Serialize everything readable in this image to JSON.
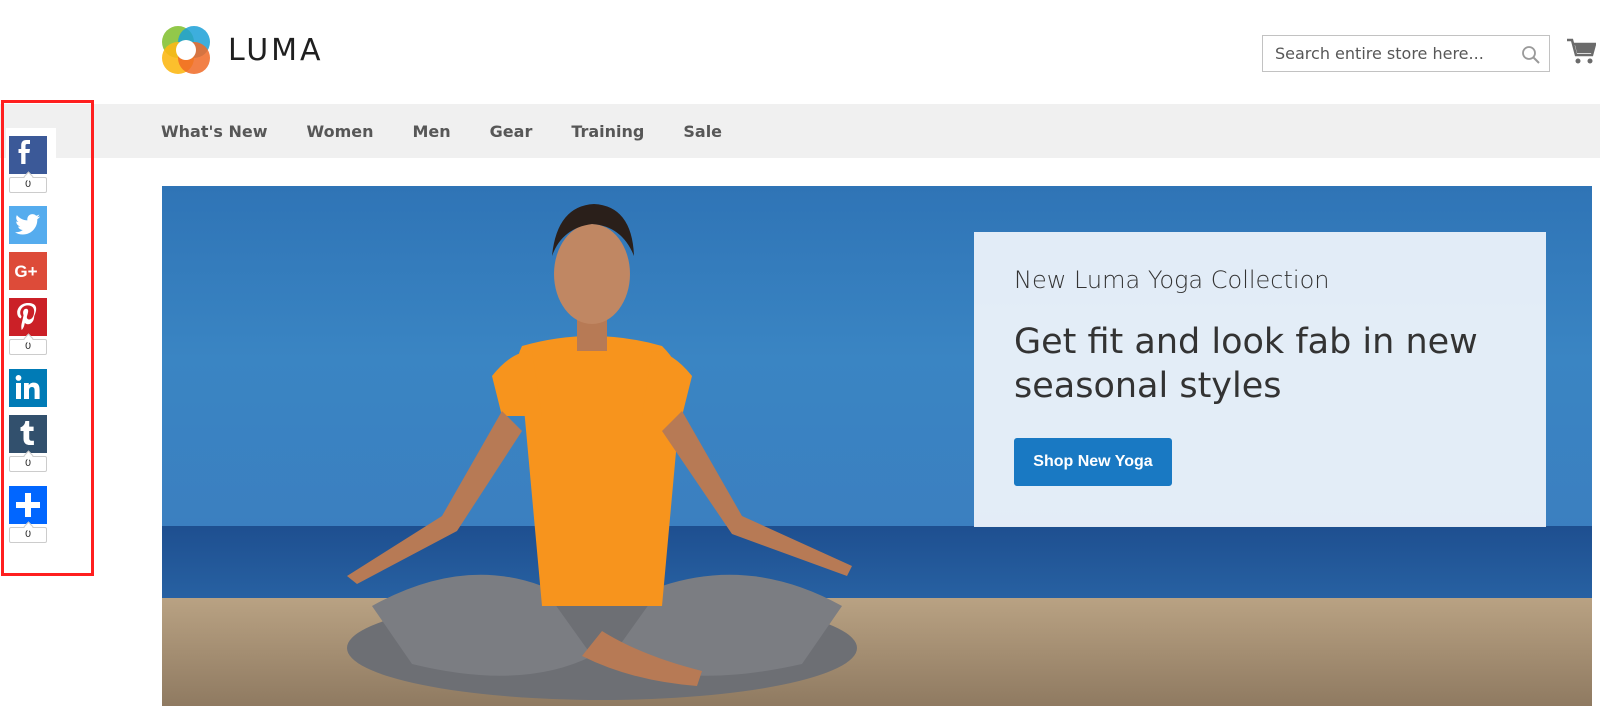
{
  "brand": {
    "name": "LUMA"
  },
  "search": {
    "placeholder": "Search entire store here..."
  },
  "nav": {
    "items": [
      "What's New",
      "Women",
      "Men",
      "Gear",
      "Training",
      "Sale"
    ]
  },
  "hero": {
    "subtitle": "New Luma Yoga Collection",
    "headline": "Get fit and look fab in new seasonal styles",
    "cta": "Shop New Yoga"
  },
  "share": {
    "buttons": [
      {
        "network": "facebook",
        "icon": "facebook-icon",
        "color": "#3b5998",
        "count": "0"
      },
      {
        "network": "twitter",
        "icon": "twitter-icon",
        "color": "#55acee",
        "count": null
      },
      {
        "network": "google-plus",
        "icon": "google-plus-icon",
        "color": "#dd4b39",
        "count": null
      },
      {
        "network": "pinterest",
        "icon": "pinterest-icon",
        "color": "#cb2027",
        "count": "0"
      },
      {
        "network": "linkedin",
        "icon": "linkedin-icon",
        "color": "#007bb6",
        "count": null
      },
      {
        "network": "tumblr",
        "icon": "tumblr-icon",
        "color": "#32506d",
        "count": "0"
      },
      {
        "network": "share-more",
        "icon": "plus-icon",
        "color": "#0166ff",
        "count": "0"
      }
    ]
  },
  "colors": {
    "primary_button": "#1979c3",
    "nav_background": "#f0f0f0",
    "highlight_frame": "#ff1f1f"
  }
}
